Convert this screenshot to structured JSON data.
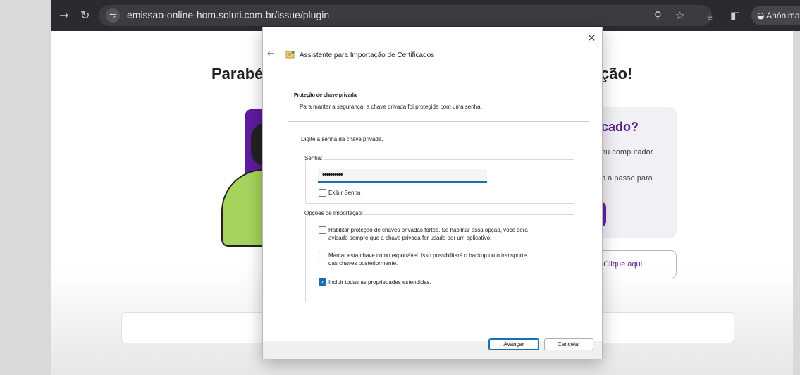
{
  "browser": {
    "url": "emissao-online-hom.soluti.com.br/issue/plugin",
    "incognito_label": "Anônima",
    "icons": [
      "forward-icon",
      "reload-icon",
      "site-settings-icon",
      "zoom-icon",
      "bookmark-star-icon",
      "download-icon",
      "side-panel-icon",
      "incognito-icon"
    ]
  },
  "page": {
    "heading_left": "Parabé",
    "heading_right": "ção!",
    "card_title": "cado?",
    "card_line1": "eu computador.",
    "card_line2": "o a passo para",
    "link_button": "Clique aqui"
  },
  "dialog": {
    "window_title": "Assistente para Importação de Certificados",
    "section_title": "Proteção de chave privada",
    "section_desc": "Para manter a segurança, a chave privada foi protegida com uma senha.",
    "prompt": "Digite a senha da chave privada.",
    "password_label": "Senha:",
    "password_value": "••••••••••",
    "show_password": {
      "label": "Exibir Senha",
      "checked": false
    },
    "import_options_label": "Opções de Importação:",
    "options": [
      {
        "line1": "Habilitar proteção de chaves privadas fortes. Se habilitar essa opção, você será",
        "line2": "avisado sempre que a chave privada for usada por um aplicativo.",
        "checked": false
      },
      {
        "line1": "Marcar esta chave como exportável. Isso possibilitará o backup ou o transporte",
        "line2": "das chaves posteriormente.",
        "checked": false
      },
      {
        "line1": "Incluir todas as propriedades estendidas.",
        "line2": "",
        "checked": true
      }
    ],
    "next_button": "Avançar",
    "cancel_button": "Cancelar",
    "close_glyph": "✕",
    "back_glyph": "←"
  }
}
